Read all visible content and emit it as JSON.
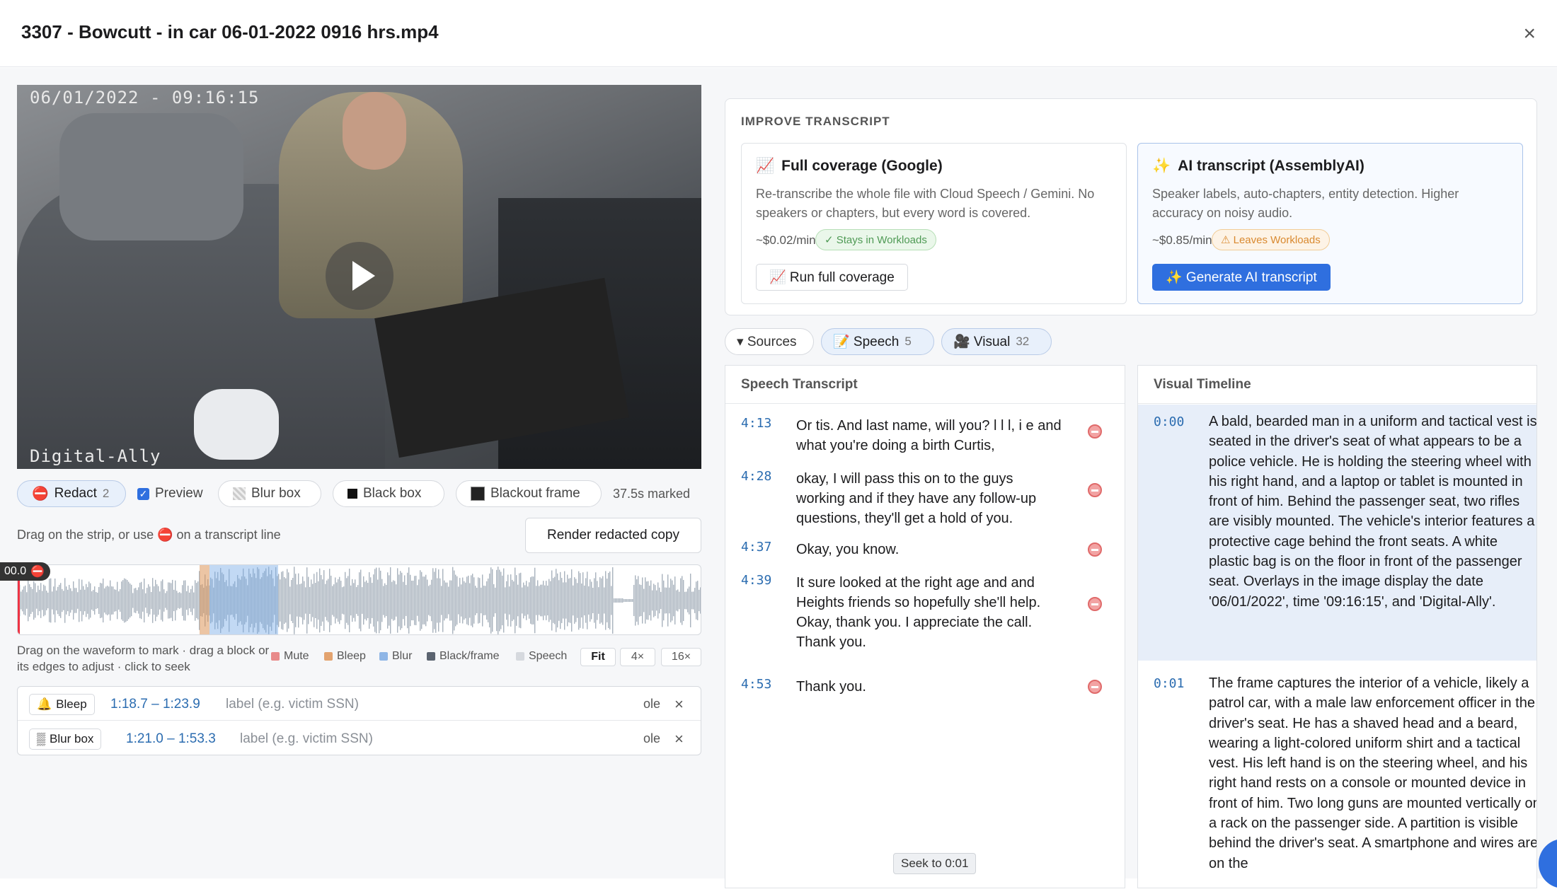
{
  "header": {
    "title": "3307 - Bowcutt - in car 06-01-2022 0916 hrs.mp4",
    "close": "×"
  },
  "video": {
    "timestamp_overlay": "06/01/2022 - 09:16:15",
    "brand_overlay": "Digital-Ally"
  },
  "toolbar": {
    "redact_label": "Redact",
    "redact_count": "2",
    "redact_icon": "⛔",
    "preview_label": "Preview",
    "preview_checked": true,
    "blur_box": "Blur box",
    "black_box": "Black box",
    "blackout_frame": "Blackout frame",
    "marked": "37.5s marked"
  },
  "hint_drag": "Drag on the strip, or use ⛔ on a transcript line",
  "render_button": "Render redacted copy",
  "waveform": {
    "playhead_tag": "00.0",
    "hint": "Drag on the waveform to mark · drag a block or its edges to adjust · click to seek",
    "legend": [
      {
        "label": "Mute",
        "color": "#e88a8a"
      },
      {
        "label": "Bleep",
        "color": "#e3a36f"
      },
      {
        "label": "Blur",
        "color": "#8fb6e6"
      },
      {
        "label": "Black/frame",
        "color": "#5b6470"
      },
      {
        "label": "Speech",
        "color": "#d6d9de"
      }
    ],
    "zoom": [
      "Fit",
      "4×",
      "16×"
    ]
  },
  "redactions": [
    {
      "type": "Bleep",
      "icon": "🔔",
      "range": "1:18.7 – 1:23.9",
      "label_placeholder": "label (e.g. victim SSN)",
      "role": "ole",
      "remove": "×"
    },
    {
      "type": "Blur box",
      "icon": "▒",
      "range": "1:21.0 – 1:53.3",
      "label_placeholder": "label (e.g. victim SSN)",
      "role": "ole",
      "remove": "×"
    }
  ],
  "improve": {
    "heading": "IMPROVE TRANSCRIPT",
    "google": {
      "icon": "📈",
      "title": "Full coverage (Google)",
      "desc": "Re-transcribe the whole file with Cloud Speech / Gemini. No speakers or chapters, but every word is covered.",
      "price": "~$0.02/min",
      "badge": "✓ Stays in Workloads",
      "button": "📈 Run full coverage"
    },
    "ai": {
      "icon": "✨",
      "title": "AI transcript (AssemblyAI)",
      "desc": "Speaker labels, auto-chapters, entity detection. Higher accuracy on noisy audio.",
      "price": "~$0.85/min",
      "badge": "⚠ Leaves Workloads",
      "button": "✨ Generate AI transcript"
    }
  },
  "chips": {
    "sources": "▾ Sources",
    "speech": "📝 Speech",
    "speech_count": "5",
    "visual": "🎥 Visual",
    "visual_count": "32"
  },
  "speech": {
    "heading": "Speech Transcript",
    "lines": [
      {
        "time": "4:13",
        "text": "Or tis. And last name, will you? l l l, i e and what you're doing a birth Curtis,"
      },
      {
        "time": "4:28",
        "text": "okay, I will pass this on to the guys working and if they have any follow-up questions, they'll get a hold of you."
      },
      {
        "time": "4:37",
        "text": "Okay, you know."
      },
      {
        "time": "4:39",
        "text": "It sure looked at the right age and and Heights friends so hopefully she'll help. Okay, thank you. I appreciate the call. Thank you."
      },
      {
        "time": "4:53",
        "text": "Thank you."
      }
    ]
  },
  "visual": {
    "heading": "Visual Timeline",
    "rows": [
      {
        "time": "0:00",
        "text": "A bald, bearded man in a uniform and tactical vest is seated in the driver's seat of what appears to be a police vehicle. He is holding the steering wheel with his right hand, and a laptop or tablet is mounted in front of him. Behind the passenger seat, two rifles are visibly mounted. The vehicle's interior features a protective cage behind the front seats. A white plastic bag is on the floor in front of the passenger seat. Overlays in the image display the date '06/01/2022', time '09:16:15', and 'Digital-Ally'."
      },
      {
        "time": "0:01",
        "text": "The frame captures the interior of a vehicle, likely a patrol car, with a male law enforcement officer in the driver's seat. He has a shaved head and a beard, wearing a light-colored uniform shirt and a tactical vest. His left hand is on the steering wheel, and his right hand rests on a console or mounted device in front of him. Two long guns are mounted vertically on a rack on the passenger side. A partition is visible behind the driver's seat. A smartphone and wires are on the"
      }
    ]
  },
  "seek_tooltip": "Seek to 0:01"
}
